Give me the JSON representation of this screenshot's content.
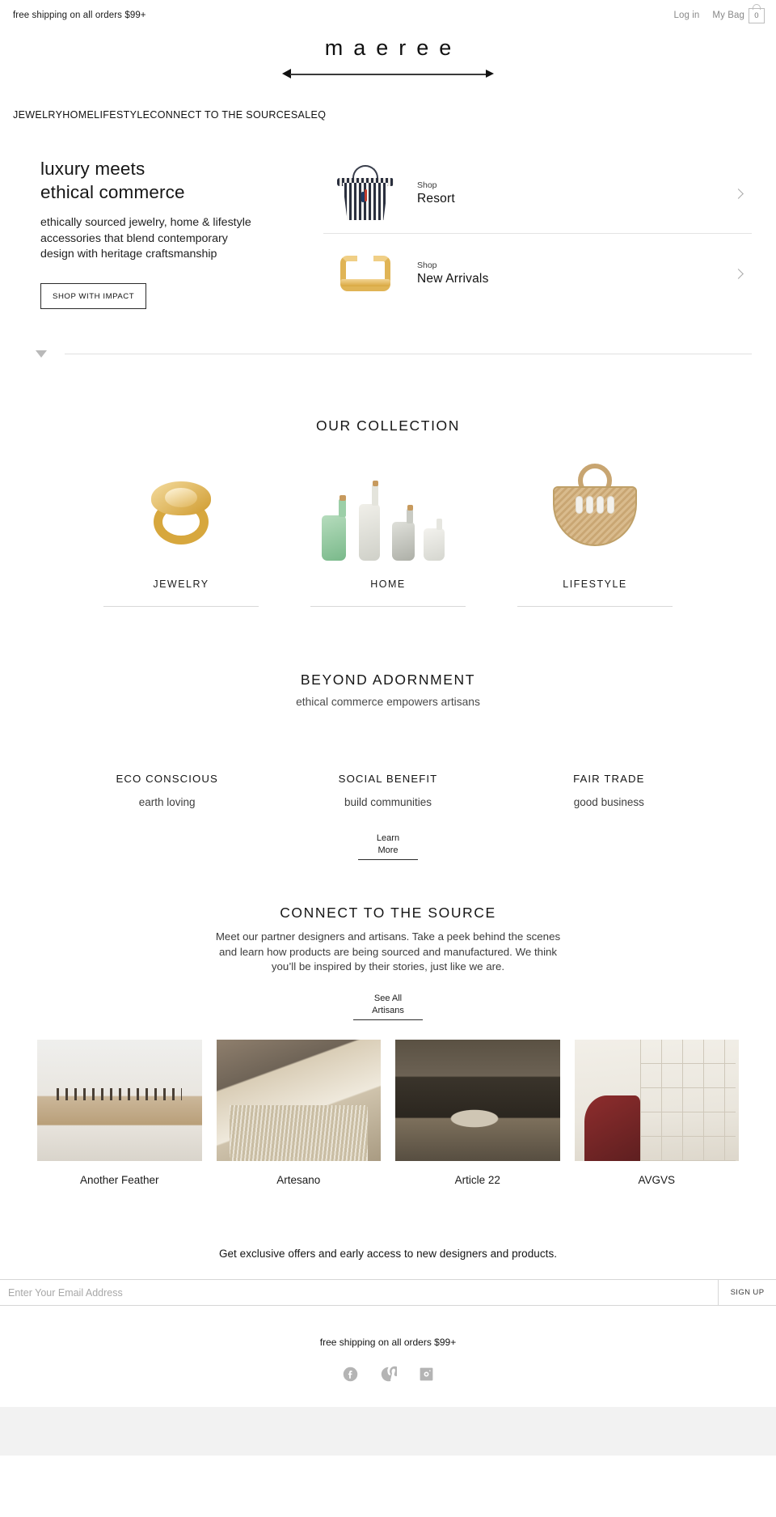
{
  "utility": {
    "shipping_note": "free shipping on all orders $99+",
    "login_label": "Log in",
    "bag_label": "My Bag",
    "bag_count": "0"
  },
  "brand": {
    "logo_text": "maeree"
  },
  "nav": {
    "items": [
      {
        "label": "JEWELRY",
        "name": "nav-jewelry"
      },
      {
        "label": "HOME",
        "name": "nav-home"
      },
      {
        "label": "LIFESTYLE",
        "name": "nav-lifestyle"
      },
      {
        "label": "CONNECT TO THE SOURCE",
        "name": "nav-connect"
      },
      {
        "label": "SALE",
        "name": "nav-sale"
      },
      {
        "label": "Q",
        "name": "nav-search"
      }
    ]
  },
  "hero": {
    "headline_line1": "luxury meets",
    "headline_line2": "ethical commerce",
    "sub_line1": "ethically sourced jewelry, home & lifestyle",
    "sub_line2": "accessories that blend contemporary",
    "sub_line3": "design with heritage craftsmanship",
    "cta_label": "SHOP WITH IMPACT",
    "cards": [
      {
        "eyebrow": "Shop",
        "title": "Resort"
      },
      {
        "eyebrow": "Shop",
        "title": "New Arrivals"
      }
    ]
  },
  "collection": {
    "title": "OUR COLLECTION",
    "items": [
      {
        "label": "JEWELRY"
      },
      {
        "label": "HOME"
      },
      {
        "label": "LIFESTYLE"
      }
    ]
  },
  "beyond": {
    "title": "BEYOND ADORNMENT",
    "subtitle": "ethical commerce empowers artisans",
    "values": [
      {
        "title": "ECO CONSCIOUS",
        "sub": "earth loving"
      },
      {
        "title": "SOCIAL BENEFIT",
        "sub": "build communities"
      },
      {
        "title": "FAIR TRADE",
        "sub": "good business"
      }
    ],
    "learn_more_line1": "Learn",
    "learn_more_line2": "More"
  },
  "connect": {
    "title": "CONNECT TO THE SOURCE",
    "copy_line1": "Meet our partner designers and artisans. Take a peek behind the scenes",
    "copy_line2": "and learn how products are being sourced and manufactured. We think",
    "copy_line3": "you’ll be inspired by their stories, just like we are.",
    "see_all_line1": "See All",
    "see_all_line2": "Artisans",
    "artisans": [
      {
        "name": "Another Feather"
      },
      {
        "name": "Artesano"
      },
      {
        "name": "Article 22"
      },
      {
        "name": "AVGVS"
      }
    ]
  },
  "newsletter": {
    "heading": "Get exclusive offers and early access to new designers and products.",
    "placeholder": "Enter Your Email Address",
    "value": "",
    "button_label": "SIGN UP"
  },
  "footer": {
    "shipping_note": "free shipping on all orders $99+",
    "socials": [
      {
        "name": "facebook-icon"
      },
      {
        "name": "pinterest-icon"
      },
      {
        "name": "instagram-icon"
      }
    ]
  },
  "colors": {
    "text": "#161616",
    "muted": "#8a8a8a",
    "rule": "#e0e0e0",
    "footer_strip": "#f2f2f2"
  }
}
